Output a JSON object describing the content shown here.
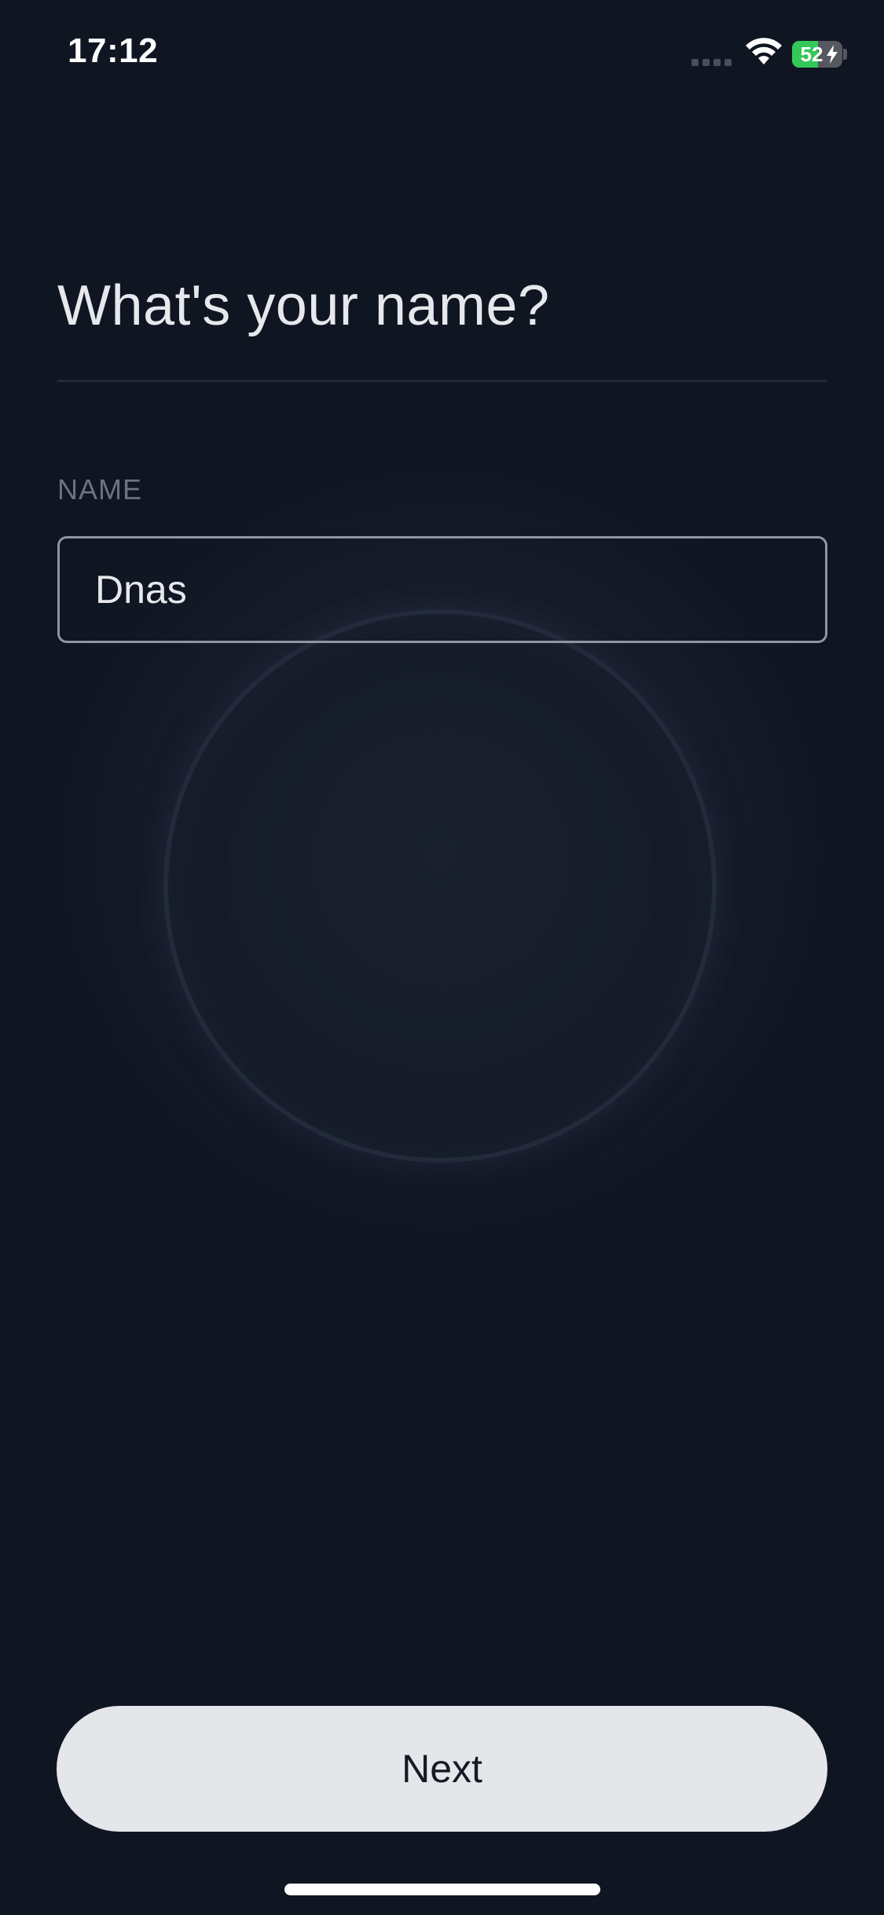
{
  "status_bar": {
    "time": "17:12",
    "battery_percent": "52",
    "battery_level": 0.52,
    "charging": true,
    "icons": [
      "cellular-signal-icon",
      "wifi-icon",
      "battery-icon",
      "charging-bolt-icon"
    ]
  },
  "screen": {
    "title": "What's your name?",
    "field_label": "NAME",
    "name_value": "Dnas",
    "next_label": "Next"
  },
  "colors": {
    "background": "#101522",
    "title_text": "#e6e8ec",
    "label_text": "#6c7282",
    "input_border": "#8f95a2",
    "button_bg": "#e5e6e9",
    "button_text": "#151a26",
    "battery_green": "#34c759"
  }
}
